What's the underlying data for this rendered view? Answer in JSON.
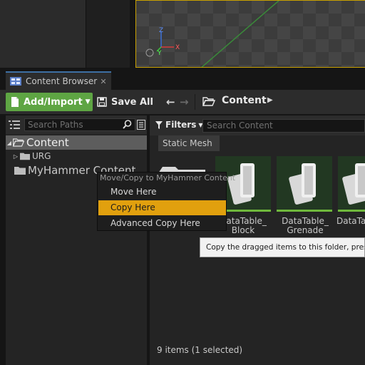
{
  "tab": {
    "label": "Content Browser",
    "close_glyph": "✕"
  },
  "toolbar": {
    "add_import_label": "Add/Import",
    "save_all_label": "Save All",
    "breadcrumb_label": "Content"
  },
  "paths": {
    "search_placeholder": "Search Paths",
    "tree": [
      {
        "label": "Content",
        "expanded": true,
        "selected": true
      },
      {
        "label": "URG",
        "expanded": false
      },
      {
        "label": "MyHammer Content"
      }
    ]
  },
  "content": {
    "filters_label": "Filters",
    "search_placeholder": "Search Content",
    "filter_chip": "Static Mesh",
    "assets": [
      {
        "label": "DataTable_ Block",
        "icon": "datatable-icon"
      },
      {
        "label": "DataTable_ Grenade",
        "icon": "datatable-icon"
      },
      {
        "label": "DataTa",
        "icon": "datatable-icon"
      }
    ],
    "status": "9 items (1 selected)"
  },
  "context_menu": {
    "title": "Move/Copy to MyHammer Content",
    "items": [
      "Move Here",
      "Copy Here",
      "Advanced Copy Here"
    ],
    "highlighted": "Copy Here"
  },
  "tooltip": {
    "text": "Copy the dragged items to this folder, preser"
  },
  "gizmo": {
    "axis_z": "Z",
    "axis_y": "Y",
    "axis_x": "X"
  },
  "colors": {
    "accent_green": "#5ea543",
    "highlight_orange": "#e1a00e",
    "selection_gray": "#5d5d5d",
    "tab_blue": "#3d6fa3"
  }
}
